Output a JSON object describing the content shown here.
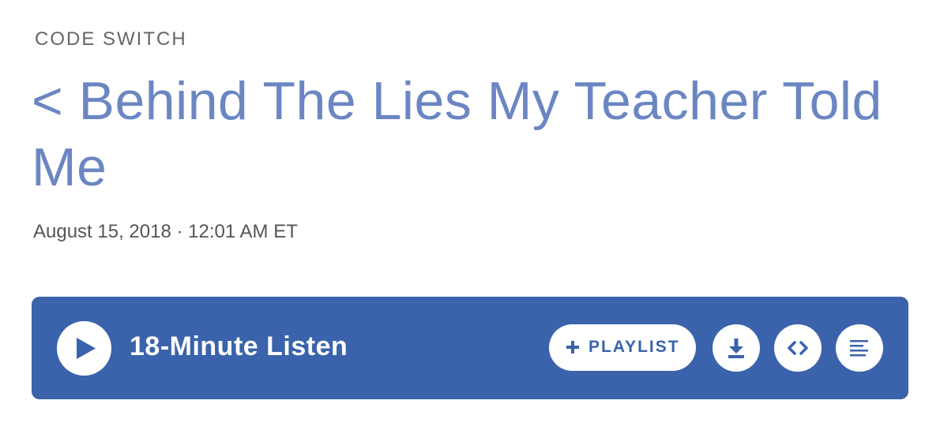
{
  "program": {
    "label": "CODE SWITCH"
  },
  "story": {
    "title": "< Behind The Lies My Teacher Told Me",
    "dateline": "August 15, 2018 · 12:01 AM ET"
  },
  "audio": {
    "listen_label": "18-Minute Listen",
    "playlist_label": "PLAYLIST",
    "play_icon": "play-icon",
    "plus_icon": "plus-icon",
    "download_icon": "download-icon",
    "embed_icon": "embed-code-icon",
    "transcript_icon": "transcript-icon"
  },
  "colors": {
    "title": "#6b86c2",
    "bar": "#3a63ab",
    "program": "#666666",
    "dateline": "#555555"
  }
}
